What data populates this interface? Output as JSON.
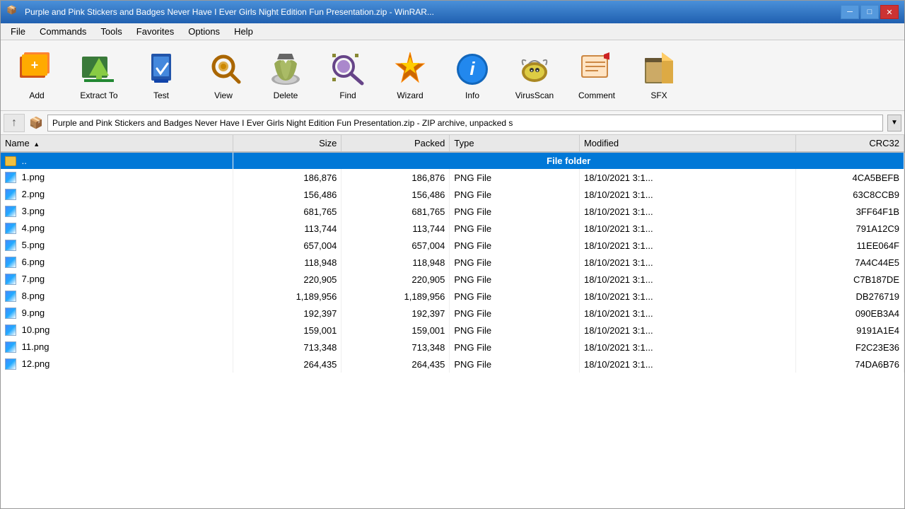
{
  "window": {
    "title": "Purple and Pink Stickers and Badges Never Have I Ever Girls Night Edition Fun Presentation.zip - WinRAR...",
    "icon": "📦"
  },
  "title_bar": {
    "buttons": {
      "minimize": "─",
      "maximize": "□",
      "close": "✕"
    }
  },
  "menu": {
    "items": [
      "File",
      "Commands",
      "Tools",
      "Favorites",
      "Options",
      "Help"
    ]
  },
  "toolbar": {
    "buttons": [
      {
        "id": "add",
        "label": "Add",
        "icon": "🎁",
        "icon_name": "add-icon"
      },
      {
        "id": "extract",
        "label": "Extract To",
        "icon": "📤",
        "icon_name": "extract-icon"
      },
      {
        "id": "test",
        "label": "Test",
        "icon": "🧪",
        "icon_name": "test-icon"
      },
      {
        "id": "view",
        "label": "View",
        "icon": "🔍",
        "icon_name": "view-icon"
      },
      {
        "id": "delete",
        "label": "Delete",
        "icon": "♻️",
        "icon_name": "delete-icon"
      },
      {
        "id": "find",
        "label": "Find",
        "icon": "🔭",
        "icon_name": "find-icon"
      },
      {
        "id": "wizard",
        "label": "Wizard",
        "icon": "🧙",
        "icon_name": "wizard-icon"
      },
      {
        "id": "info",
        "label": "Info",
        "icon": "ℹ️",
        "icon_name": "info-icon"
      },
      {
        "id": "virusscan",
        "label": "VirusScan",
        "icon": "🐛",
        "icon_name": "virusscan-icon"
      },
      {
        "id": "comment",
        "label": "Comment",
        "icon": "📝",
        "icon_name": "comment-icon"
      },
      {
        "id": "sfx",
        "label": "SFX",
        "icon": "📦",
        "icon_name": "sfx-icon"
      }
    ]
  },
  "address_bar": {
    "path": "Purple and Pink Stickers and Badges Never Have I Ever Girls Night Edition Fun Presentation.zip - ZIP archive, unpacked s",
    "up_button": "↑"
  },
  "columns": [
    {
      "id": "name",
      "label": "Name",
      "sort": "asc"
    },
    {
      "id": "size",
      "label": "Size",
      "align": "right"
    },
    {
      "id": "packed",
      "label": "Packed",
      "align": "right"
    },
    {
      "id": "type",
      "label": "Type"
    },
    {
      "id": "modified",
      "label": "Modified"
    },
    {
      "id": "crc32",
      "label": "CRC32",
      "align": "right"
    }
  ],
  "files": [
    {
      "name": "..",
      "size": "",
      "packed": "",
      "type": "File folder",
      "modified": "",
      "crc32": "",
      "is_folder": true,
      "selected": true
    },
    {
      "name": "1.png",
      "size": "186,876",
      "packed": "186,876",
      "type": "PNG File",
      "modified": "18/10/2021 3:1...",
      "crc32": "4CA5BEFB",
      "is_folder": false,
      "selected": false
    },
    {
      "name": "2.png",
      "size": "156,486",
      "packed": "156,486",
      "type": "PNG File",
      "modified": "18/10/2021 3:1...",
      "crc32": "63C8CCB9",
      "is_folder": false,
      "selected": false
    },
    {
      "name": "3.png",
      "size": "681,765",
      "packed": "681,765",
      "type": "PNG File",
      "modified": "18/10/2021 3:1...",
      "crc32": "3FF64F1B",
      "is_folder": false,
      "selected": false
    },
    {
      "name": "4.png",
      "size": "113,744",
      "packed": "113,744",
      "type": "PNG File",
      "modified": "18/10/2021 3:1...",
      "crc32": "791A12C9",
      "is_folder": false,
      "selected": false
    },
    {
      "name": "5.png",
      "size": "657,004",
      "packed": "657,004",
      "type": "PNG File",
      "modified": "18/10/2021 3:1...",
      "crc32": "11EE064F",
      "is_folder": false,
      "selected": false
    },
    {
      "name": "6.png",
      "size": "118,948",
      "packed": "118,948",
      "type": "PNG File",
      "modified": "18/10/2021 3:1...",
      "crc32": "7A4C44E5",
      "is_folder": false,
      "selected": false
    },
    {
      "name": "7.png",
      "size": "220,905",
      "packed": "220,905",
      "type": "PNG File",
      "modified": "18/10/2021 3:1...",
      "crc32": "C7B187DE",
      "is_folder": false,
      "selected": false
    },
    {
      "name": "8.png",
      "size": "1,189,956",
      "packed": "1,189,956",
      "type": "PNG File",
      "modified": "18/10/2021 3:1...",
      "crc32": "DB276719",
      "is_folder": false,
      "selected": false
    },
    {
      "name": "9.png",
      "size": "192,397",
      "packed": "192,397",
      "type": "PNG File",
      "modified": "18/10/2021 3:1...",
      "crc32": "090EB3A4",
      "is_folder": false,
      "selected": false
    },
    {
      "name": "10.png",
      "size": "159,001",
      "packed": "159,001",
      "type": "PNG File",
      "modified": "18/10/2021 3:1...",
      "crc32": "9191A1E4",
      "is_folder": false,
      "selected": false
    },
    {
      "name": "11.png",
      "size": "713,348",
      "packed": "713,348",
      "type": "PNG File",
      "modified": "18/10/2021 3:1...",
      "crc32": "F2C23E36",
      "is_folder": false,
      "selected": false
    },
    {
      "name": "12.png",
      "size": "264,435",
      "packed": "264,435",
      "type": "PNG File",
      "modified": "18/10/2021 3:1...",
      "crc32": "74DA6B76",
      "is_folder": false,
      "selected": false
    }
  ]
}
